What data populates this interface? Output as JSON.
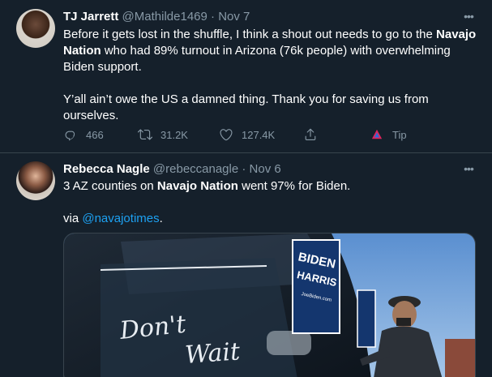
{
  "tweets": [
    {
      "name": "TJ Jarrett",
      "handle": "@Mathilde1469",
      "sep": " · ",
      "date": "Nov 7",
      "line1_pre": "Before it gets lost in the shuffle, I think a shout out needs to go to the ",
      "line1_bold": "Navajo Nation",
      "line1_post": " who had 89% turnout in Arizona (76k people) with overwhelming Biden support.",
      "line2": "Y’all ain’t owe the US a damned thing. Thank you for saving us from ourselves.",
      "replies": "466",
      "retweets": "31.2K",
      "likes": "127.4K",
      "tip_label": "Tip"
    },
    {
      "name": "Rebecca Nagle",
      "handle": "@rebeccanagle",
      "sep": " · ",
      "date": "Nov 6",
      "text_pre": "3 AZ counties on ",
      "text_bold": "Navajo Nation",
      "text_post": " went 97% for Biden.",
      "via_pre": "via ",
      "via_link": "@navajotimes",
      "via_post": ".",
      "image": {
        "sign_line1": "BIDEN",
        "sign_line2": "HARRIS",
        "sign_url": "JoeBiden.com",
        "car_script_1": "Don't",
        "car_script_2": "Wait"
      }
    }
  ],
  "colors": {
    "background": "#15202b",
    "muted": "#8899a6",
    "link": "#1da1f2",
    "divider": "#38444d"
  }
}
